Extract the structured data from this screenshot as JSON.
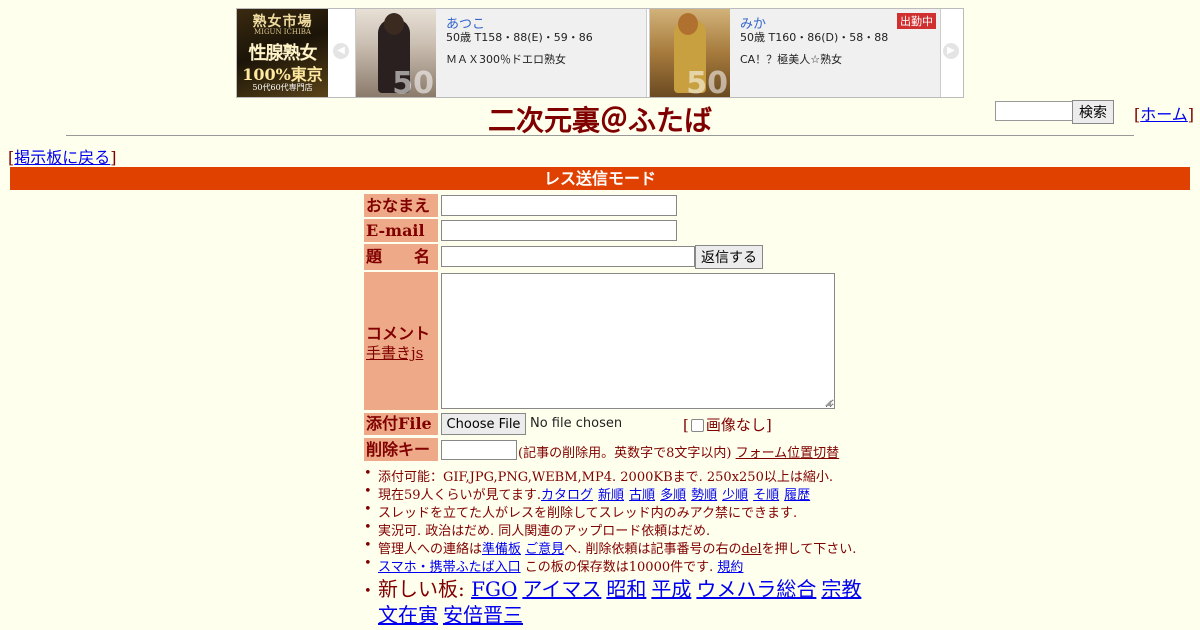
{
  "banner": {
    "logo": {
      "line1": "熟女市場",
      "line2": "MIGUN ICHIBA",
      "line3": "性腺熟女",
      "line4": "100%東京",
      "line5": "50代60代専門店"
    },
    "prev_arrow": "◀",
    "next_arrow": "▶",
    "cards": [
      {
        "name": "あつこ",
        "stats": "50歳 T158・88(E)・59・86",
        "desc": "ＭＡＸ300％ドエロ熟女",
        "photo_overlay": "50",
        "badge": ""
      },
      {
        "name": "みか",
        "stats": "50歳 T160・86(D)・58・88",
        "desc": "CA！？極美人☆熟女",
        "photo_overlay": "50",
        "badge": "出勤中"
      }
    ]
  },
  "header": {
    "title": "二次元裏＠ふたば",
    "search_button": "検索",
    "home_open": "[",
    "home_link": "ホーム",
    "home_close": "]",
    "back_open": "[",
    "back_link": "掲示板に戻る",
    "back_close": "]"
  },
  "mode_bar": "レス送信モード",
  "form": {
    "name_label": "おなまえ",
    "email_label": "E-mail",
    "subject_label": "題　　名",
    "submit_button": "返信する",
    "comment_label": "コメント",
    "handwriting_link": "手書きjs",
    "file_label": "添付File",
    "file_button": "Choose File",
    "file_status": "No file chosen",
    "no_image_open": "[",
    "no_image_label": "画像なし]",
    "delkey_label": "削除キー",
    "delkey_note": "(記事の削除用。英数字で8文字以内)",
    "form_position_link": "フォーム位置切替"
  },
  "notes": {
    "bullet": "•",
    "n1": "添付可能：GIF,JPG,PNG,WEBM,MP4. 2000KBまで. 250x250以上は縮小.",
    "n2_prefix": "現在59人くらいが見てます.",
    "n2_links": [
      "カタログ",
      "新順",
      "古順",
      "多順",
      "勢順",
      "少順",
      "そ順",
      "履歴"
    ],
    "n3": "スレッドを立てた人がレスを削除してスレッド内のみアク禁にできます.",
    "n4": "実況可. 政治はだめ. 同人関連のアップロード依頼はだめ.",
    "n5_a": "管理人への連絡は",
    "n5_link1": "準備板",
    "n5_link2": "ご意見",
    "n5_b": "へ. 削除依頼は記事番号の右の",
    "n5_link3": "del",
    "n5_c": "を押して下さい.",
    "n6_link1": "スマホ・携帯ふたば入口",
    "n6_text": "この板の保存数は10000件です.",
    "n6_link2": "規約",
    "n7_prefix": "新しい板:",
    "n7_links": [
      "FGO",
      "アイマス",
      "昭和",
      "平成",
      "ウメハラ総合",
      "宗教",
      "文在寅",
      "安倍晋三"
    ]
  }
}
